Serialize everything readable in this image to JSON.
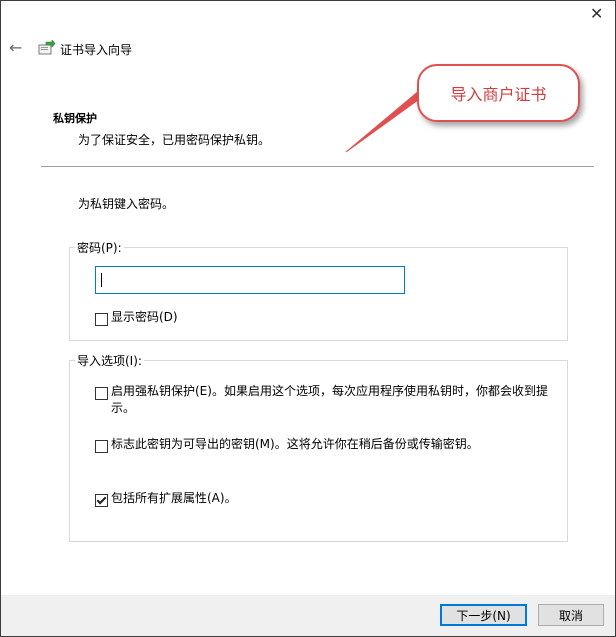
{
  "window": {
    "close_glyph": "✕",
    "back_glyph": "←",
    "title": "证书导入向导"
  },
  "header": {
    "section_title": "私钥保护",
    "section_desc": "为了保证安全，已用密码保护私钥。"
  },
  "main": {
    "prompt": "为私钥键入密码。",
    "password_group": {
      "legend": "密码(P):",
      "value": "",
      "show_password_label": "显示密码(D)",
      "show_password_checked": false
    },
    "options_group": {
      "legend": "导入选项(I):",
      "options": [
        {
          "label": "启用强私钥保护(E)。如果启用这个选项，每次应用程序使用私钥时，你都会收到提示。",
          "checked": false
        },
        {
          "label": "标志此密钥为可导出的密钥(M)。这将允许你在稍后备份或传输密钥。",
          "checked": false
        },
        {
          "label": "包括所有扩展属性(A)。",
          "checked": true
        }
      ]
    }
  },
  "footer": {
    "next_label": "下一步(N)",
    "cancel_label": "取消"
  },
  "annotation": {
    "callout_text": "导入商户证书",
    "color": "#d23c3c"
  }
}
